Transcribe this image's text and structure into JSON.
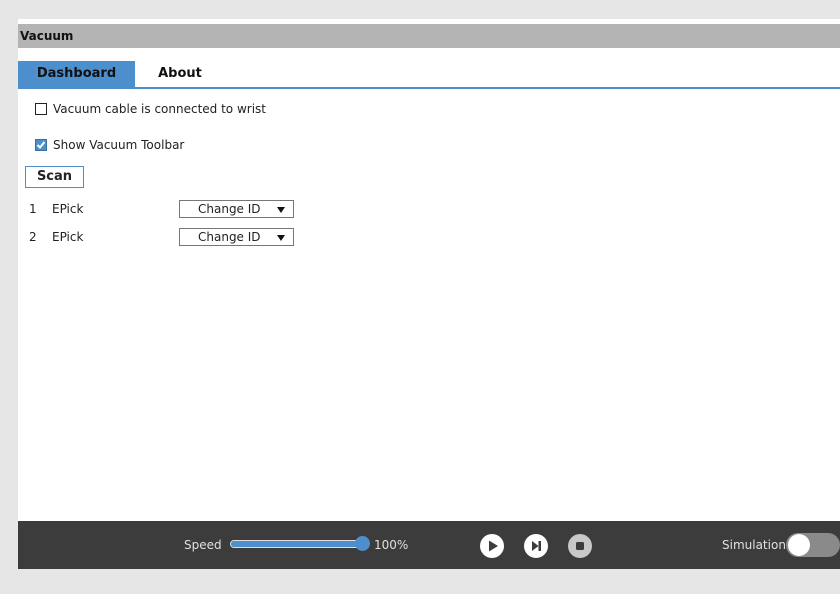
{
  "window": {
    "title": "Vacuum"
  },
  "tabs": [
    {
      "label": "Dashboard",
      "active": true
    },
    {
      "label": "About",
      "active": false
    }
  ],
  "options": {
    "cable_connected": {
      "label": "Vacuum cable is connected to wrist",
      "checked": false
    },
    "show_toolbar": {
      "label": "Show Vacuum Toolbar",
      "checked": true
    }
  },
  "scan_button": {
    "label": "Scan"
  },
  "devices": [
    {
      "index": "1",
      "name": "EPick",
      "action": "Change ID"
    },
    {
      "index": "2",
      "name": "EPick",
      "action": "Change ID"
    }
  ],
  "footer": {
    "speed_label": "Speed",
    "speed_value": "100%",
    "speed_fraction": 1.0,
    "simulation_label": "Simulation",
    "simulation_on": false,
    "icons": [
      "play-icon",
      "step-forward-icon",
      "stop-icon"
    ]
  },
  "colors": {
    "accent": "#4d8fcd",
    "title_bar": "#b4b4b4",
    "footer_bar": "#3c3c3c"
  }
}
